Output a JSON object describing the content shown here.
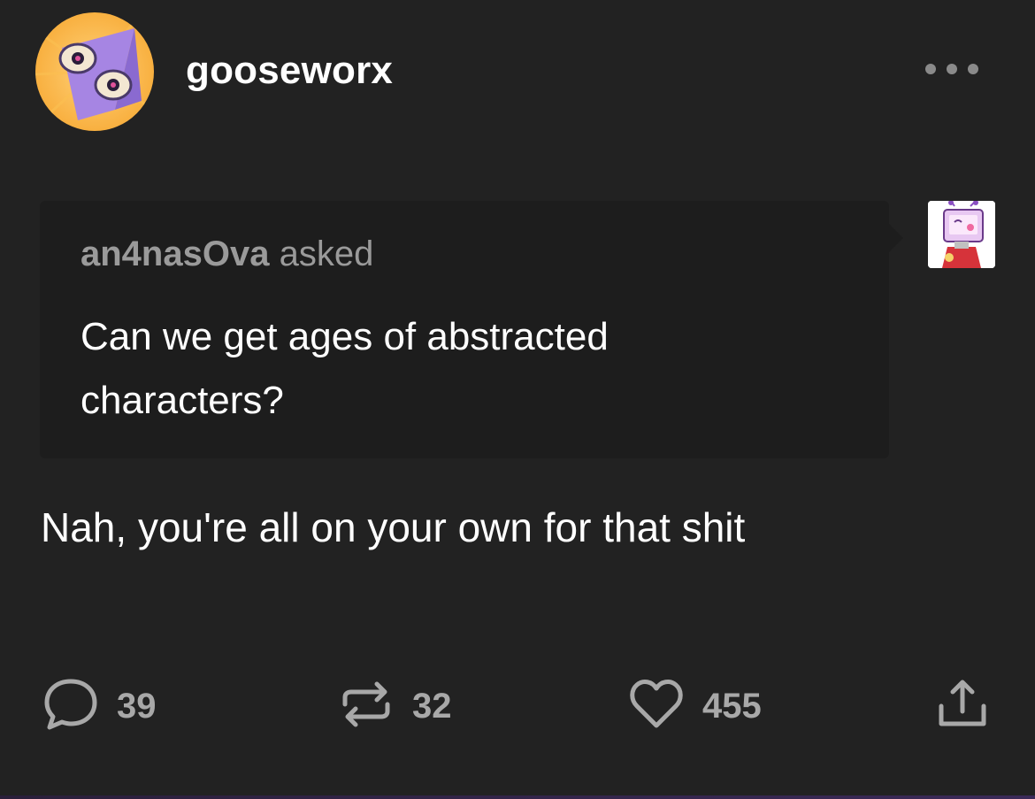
{
  "post": {
    "author": "gooseworx",
    "ask": {
      "asker": "an4nasOva",
      "verb": "asked",
      "question": "Can we get ages of abstracted characters?"
    },
    "answer": "Nah, you're all on your own for that shit"
  },
  "footer": {
    "replies": "39",
    "reblogs": "32",
    "likes": "455"
  },
  "icons": {
    "more": "more-dots-icon",
    "reply": "speech-bubble-icon",
    "reblog": "reblog-arrows-icon",
    "like": "heart-icon",
    "share": "share-icon"
  },
  "colors": {
    "background": "#222222",
    "ask_box": "#1d1d1d",
    "muted_text": "#9a9a9a",
    "icon_gray": "#a8a8a8"
  }
}
